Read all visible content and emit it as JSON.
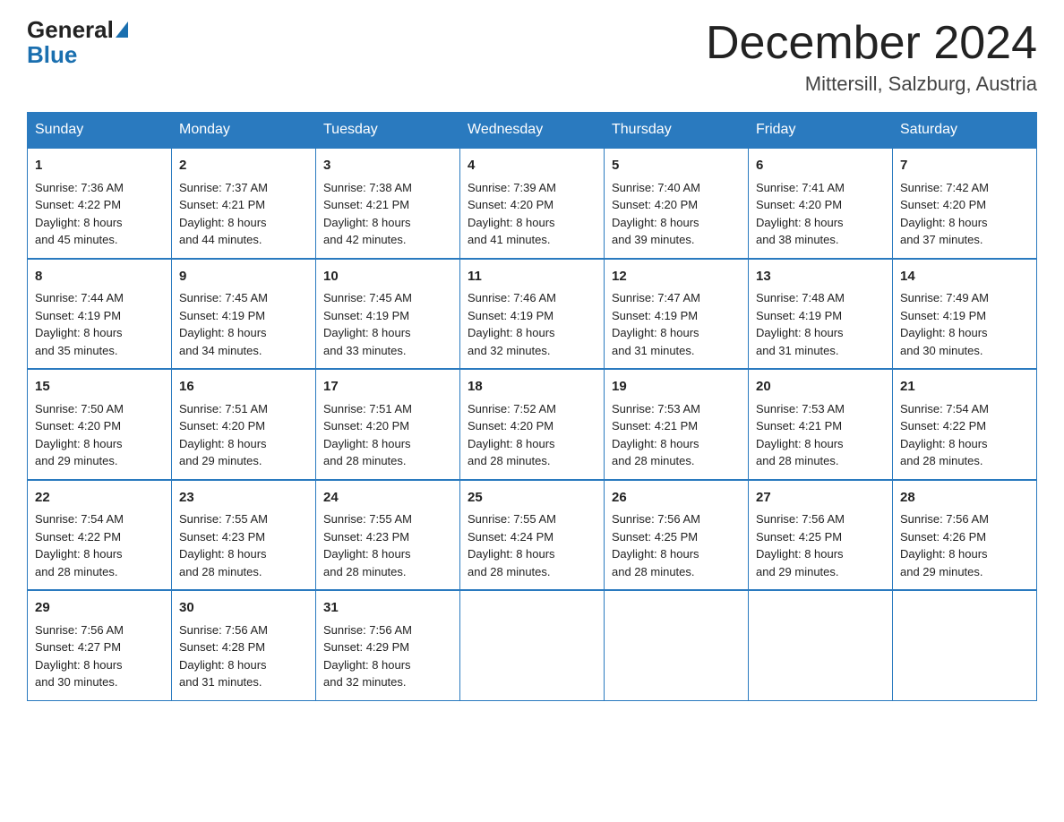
{
  "header": {
    "logo_general": "General",
    "logo_blue": "Blue",
    "month_title": "December 2024",
    "location": "Mittersill, Salzburg, Austria"
  },
  "weekdays": [
    "Sunday",
    "Monday",
    "Tuesday",
    "Wednesday",
    "Thursday",
    "Friday",
    "Saturday"
  ],
  "weeks": [
    [
      {
        "day": "1",
        "sunrise": "7:36 AM",
        "sunset": "4:22 PM",
        "daylight": "8 hours and 45 minutes."
      },
      {
        "day": "2",
        "sunrise": "7:37 AM",
        "sunset": "4:21 PM",
        "daylight": "8 hours and 44 minutes."
      },
      {
        "day": "3",
        "sunrise": "7:38 AM",
        "sunset": "4:21 PM",
        "daylight": "8 hours and 42 minutes."
      },
      {
        "day": "4",
        "sunrise": "7:39 AM",
        "sunset": "4:20 PM",
        "daylight": "8 hours and 41 minutes."
      },
      {
        "day": "5",
        "sunrise": "7:40 AM",
        "sunset": "4:20 PM",
        "daylight": "8 hours and 39 minutes."
      },
      {
        "day": "6",
        "sunrise": "7:41 AM",
        "sunset": "4:20 PM",
        "daylight": "8 hours and 38 minutes."
      },
      {
        "day": "7",
        "sunrise": "7:42 AM",
        "sunset": "4:20 PM",
        "daylight": "8 hours and 37 minutes."
      }
    ],
    [
      {
        "day": "8",
        "sunrise": "7:44 AM",
        "sunset": "4:19 PM",
        "daylight": "8 hours and 35 minutes."
      },
      {
        "day": "9",
        "sunrise": "7:45 AM",
        "sunset": "4:19 PM",
        "daylight": "8 hours and 34 minutes."
      },
      {
        "day": "10",
        "sunrise": "7:45 AM",
        "sunset": "4:19 PM",
        "daylight": "8 hours and 33 minutes."
      },
      {
        "day": "11",
        "sunrise": "7:46 AM",
        "sunset": "4:19 PM",
        "daylight": "8 hours and 32 minutes."
      },
      {
        "day": "12",
        "sunrise": "7:47 AM",
        "sunset": "4:19 PM",
        "daylight": "8 hours and 31 minutes."
      },
      {
        "day": "13",
        "sunrise": "7:48 AM",
        "sunset": "4:19 PM",
        "daylight": "8 hours and 31 minutes."
      },
      {
        "day": "14",
        "sunrise": "7:49 AM",
        "sunset": "4:19 PM",
        "daylight": "8 hours and 30 minutes."
      }
    ],
    [
      {
        "day": "15",
        "sunrise": "7:50 AM",
        "sunset": "4:20 PM",
        "daylight": "8 hours and 29 minutes."
      },
      {
        "day": "16",
        "sunrise": "7:51 AM",
        "sunset": "4:20 PM",
        "daylight": "8 hours and 29 minutes."
      },
      {
        "day": "17",
        "sunrise": "7:51 AM",
        "sunset": "4:20 PM",
        "daylight": "8 hours and 28 minutes."
      },
      {
        "day": "18",
        "sunrise": "7:52 AM",
        "sunset": "4:20 PM",
        "daylight": "8 hours and 28 minutes."
      },
      {
        "day": "19",
        "sunrise": "7:53 AM",
        "sunset": "4:21 PM",
        "daylight": "8 hours and 28 minutes."
      },
      {
        "day": "20",
        "sunrise": "7:53 AM",
        "sunset": "4:21 PM",
        "daylight": "8 hours and 28 minutes."
      },
      {
        "day": "21",
        "sunrise": "7:54 AM",
        "sunset": "4:22 PM",
        "daylight": "8 hours and 28 minutes."
      }
    ],
    [
      {
        "day": "22",
        "sunrise": "7:54 AM",
        "sunset": "4:22 PM",
        "daylight": "8 hours and 28 minutes."
      },
      {
        "day": "23",
        "sunrise": "7:55 AM",
        "sunset": "4:23 PM",
        "daylight": "8 hours and 28 minutes."
      },
      {
        "day": "24",
        "sunrise": "7:55 AM",
        "sunset": "4:23 PM",
        "daylight": "8 hours and 28 minutes."
      },
      {
        "day": "25",
        "sunrise": "7:55 AM",
        "sunset": "4:24 PM",
        "daylight": "8 hours and 28 minutes."
      },
      {
        "day": "26",
        "sunrise": "7:56 AM",
        "sunset": "4:25 PM",
        "daylight": "8 hours and 28 minutes."
      },
      {
        "day": "27",
        "sunrise": "7:56 AM",
        "sunset": "4:25 PM",
        "daylight": "8 hours and 29 minutes."
      },
      {
        "day": "28",
        "sunrise": "7:56 AM",
        "sunset": "4:26 PM",
        "daylight": "8 hours and 29 minutes."
      }
    ],
    [
      {
        "day": "29",
        "sunrise": "7:56 AM",
        "sunset": "4:27 PM",
        "daylight": "8 hours and 30 minutes."
      },
      {
        "day": "30",
        "sunrise": "7:56 AM",
        "sunset": "4:28 PM",
        "daylight": "8 hours and 31 minutes."
      },
      {
        "day": "31",
        "sunrise": "7:56 AM",
        "sunset": "4:29 PM",
        "daylight": "8 hours and 32 minutes."
      },
      null,
      null,
      null,
      null
    ]
  ],
  "labels": {
    "sunrise": "Sunrise:",
    "sunset": "Sunset:",
    "daylight": "Daylight:"
  }
}
